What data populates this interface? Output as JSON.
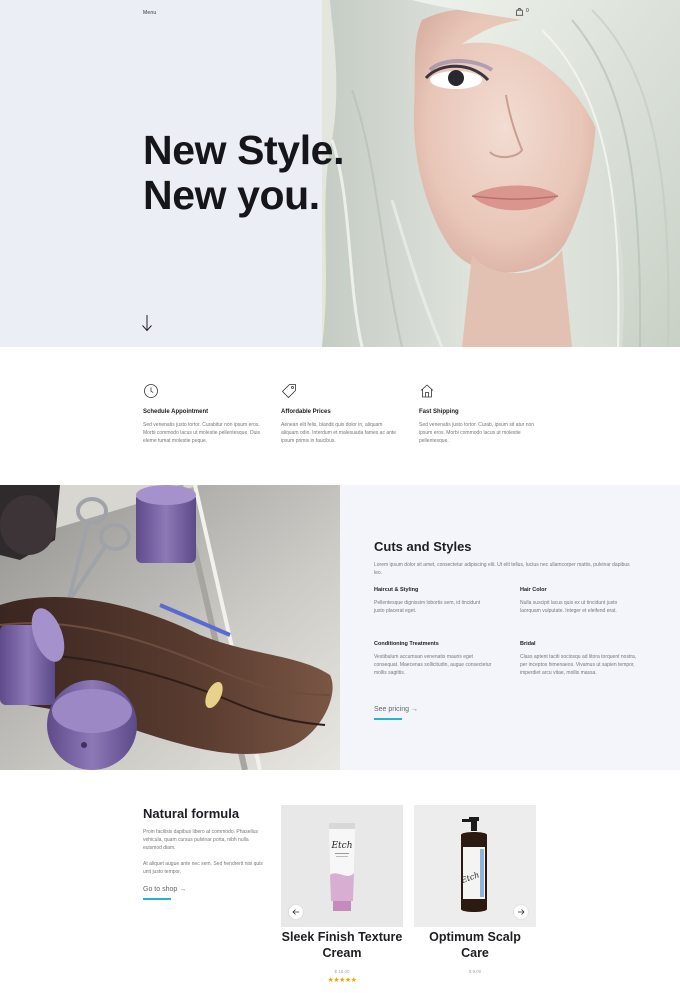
{
  "header": {
    "menu_label": "Menu",
    "cart_icon": "shopping-bag-icon",
    "cart_count": "0"
  },
  "hero": {
    "title_line1": "New Style.",
    "title_line2": "New you.",
    "scroll_icon": "arrow-down-icon",
    "background_color": "#eceef6"
  },
  "features": [
    {
      "icon": "clock-icon",
      "title": "Schedule Appointment",
      "text": "Sed venenatis justo tortor. Curabitur non ipsum eros. Morbi commodo lacus ut molestie pellentesque. Duis eleme tumat molestie peque."
    },
    {
      "icon": "price-tag-icon",
      "title": "Affordable Prices",
      "text": "Aenean elit felis, blandit quis dolor in, aliquam aliquam odio. Interdum et malesuada fames ac ante ipsum primis in faucibus."
    },
    {
      "icon": "home-icon",
      "title": "Fast Shipping",
      "text": "Sed venenatis justo tortor. Curab, ipsum sit atur non ipsum eros. Morbi commodo lacus ut molestie pellentesque."
    }
  ],
  "cuts": {
    "title": "Cuts and Styles",
    "intro": "Lorem ipsum dolor sit amet, consectetur adipiscing elit. Ut elit tellus, luctus nec ullamcorper mattis, pulvinar dapibus leo.",
    "services": [
      {
        "title": "Haircut & Styling",
        "text": "Pellentesque dignissim lobortis sem, id tincidunt justo placerat eget."
      },
      {
        "title": "Hair Color",
        "text": "Nulla suscipit lacus quis ex ut tincidunt justo laorquam vulputate. Integer et eleifend erat."
      },
      {
        "title": "Conditioning Treatments",
        "text": "Vestibulum accumsan venenatis mauris eget consequat. Maecenas sollicitudin, augue consectetur mollis sagittis."
      },
      {
        "title": "Bridal",
        "text": "Class aptent taciti sociosqu ad litora torquent nostra, per inceptos himenaeos. Vivamus ut sapien tempor, imperdiet arcu vitae, mollis massa."
      }
    ],
    "link_label": "See pricing",
    "link_arrow": "→",
    "accent_color": "#27b3c9"
  },
  "shop": {
    "title": "Natural formula",
    "paragraph1": "Proin facilisis dapibus libero at commodo. Phasellus vehicula, quam cursus pulvinar porta, nibh nulla euismod diam.",
    "paragraph2": "At aliquet augue ante nec sem. Sed hendrerit nisi quis unit justo tempor.",
    "link_label": "Go to shop",
    "link_arrow": "→",
    "products": [
      {
        "name": "Sleek Finish Texture Cream",
        "price": "$ 18.00",
        "rating": 5,
        "stars": "★★★★★",
        "brand": "Etch"
      },
      {
        "name": "Optimum Scalp Care",
        "price": "$ 9.00",
        "brand": "Etch"
      }
    ],
    "prev_icon": "arrow-left-icon",
    "next_icon": "arrow-right-icon"
  }
}
